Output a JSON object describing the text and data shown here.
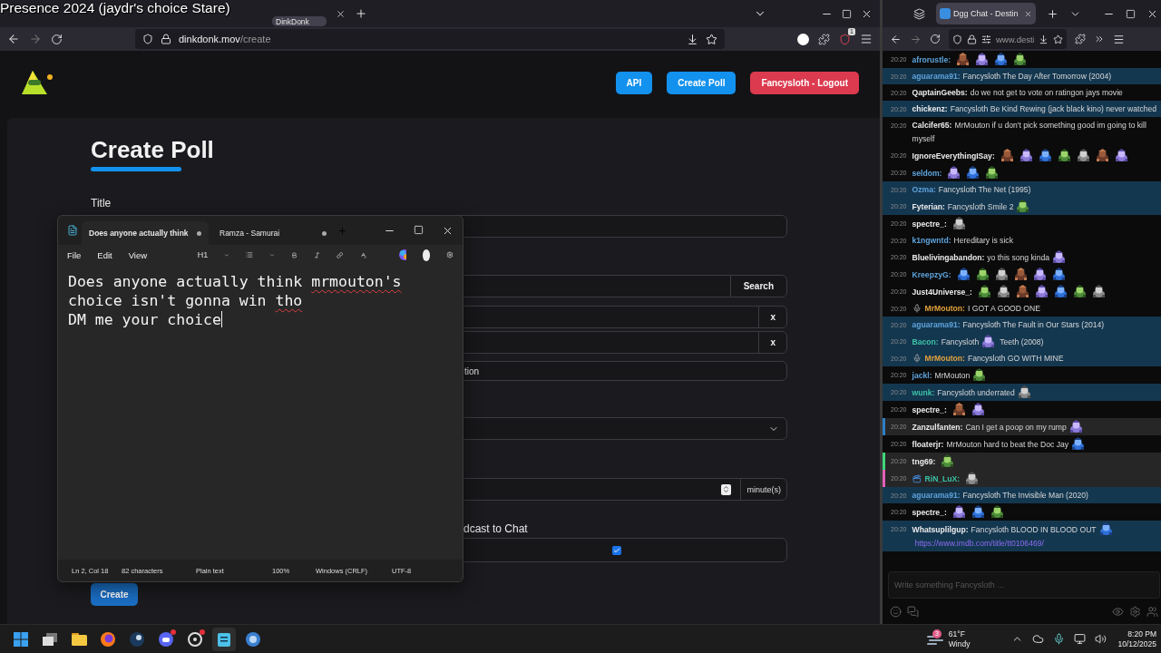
{
  "overlay_title": "Presence 2024 (jaydr's choice Stare)",
  "left_browser": {
    "tab": {
      "title": "DinkDonk",
      "selected": true
    },
    "address": {
      "host": "dinkdonk.mov",
      "path": "/create"
    },
    "extension_badge": "1",
    "header_buttons": [
      {
        "label": "API",
        "kind": "primary"
      },
      {
        "label": "Create Poll",
        "kind": "primary"
      },
      {
        "label": "Fancysloth - Logout",
        "kind": "danger"
      }
    ],
    "form": {
      "heading": "Create Poll",
      "title_label": "Title",
      "search_button": "Search",
      "options": [
        {
          "remove": "x"
        },
        {
          "remove": "x"
        }
      ],
      "partial_field_text": "tion",
      "duration_unit": "minute(s)",
      "broadcast_label": "dcast to Chat",
      "broadcast": {
        "checked": true
      },
      "create_button": "Create"
    }
  },
  "notepad": {
    "tabs": [
      {
        "title": "Does anyone actually think",
        "selected": true,
        "unsaved": true
      },
      {
        "title": "Ramza - Samurai",
        "selected": false,
        "unsaved": true
      }
    ],
    "menu": [
      "File",
      "Edit",
      "View"
    ],
    "heading_menu": "H1",
    "lines": [
      {
        "segments": [
          {
            "text": "Does anyone actually think ",
            "misspelled": false
          },
          {
            "text": "mrmouton's",
            "misspelled": true
          }
        ],
        "caret": false
      },
      {
        "segments": [
          {
            "text": "choice isn't gonna win ",
            "misspelled": false
          },
          {
            "text": "tho",
            "misspelled": true
          }
        ],
        "caret": false
      },
      {
        "segments": [
          {
            "text": "DM me your choice",
            "misspelled": false
          }
        ],
        "caret": true
      }
    ],
    "status": [
      "Ln 2, Col 18",
      "82 characters",
      "Plain text",
      "100%",
      "Windows (CRLF)",
      "UTF-8"
    ]
  },
  "right_browser": {
    "tab": {
      "title": "Dgg Chat - Destin",
      "selected": true
    },
    "address": "www.desti",
    "messages": [
      {
        "time": "20:20",
        "user": "afrorustle:",
        "color": "#5ea3dc",
        "highlighted": false
      },
      {
        "time": "20:20",
        "user": "aguarama91:",
        "color": "#5ea3dc",
        "highlighted": true,
        "text": "Fancysloth The Day After Tomorrow (2004)"
      },
      {
        "time": "20:20",
        "user": "QaptainGeebs:",
        "color": "#ececec",
        "highlighted": false,
        "text": "do we not get to vote on ratingon jays movie"
      },
      {
        "time": "20:20",
        "user": "chickenz:",
        "color": "#ececec",
        "highlighted": true,
        "text": "Fancysloth Be Kind Rewing (jack black kino) never watched"
      },
      {
        "time": "20:20",
        "user": "Calcifer65:",
        "color": "#ececec",
        "highlighted": false,
        "text": "MrMouton if u don't pick something good im going to kill myself"
      },
      {
        "time": "20:20",
        "user": "IgnoreEverythingISay:",
        "color": "#ececec",
        "highlighted": false
      },
      {
        "time": "20:20",
        "user": "seldom:",
        "color": "#5ea3dc",
        "highlighted": false
      },
      {
        "time": "20:20",
        "user": "Ozma:",
        "color": "#5ea3dc",
        "highlighted": true,
        "text": "Fancysloth The Net (1995)"
      },
      {
        "time": "20:20",
        "user": "Fyterian:",
        "color": "#ececec",
        "highlighted": true,
        "text": "Fancysloth Smile 2"
      },
      {
        "time": "20:20",
        "user": "spectre_:",
        "color": "#ececec",
        "highlighted": false
      },
      {
        "time": "20:20",
        "user": "k1ngwntd:",
        "color": "#5ea3dc",
        "highlighted": false,
        "text": "Hereditary is sick"
      },
      {
        "time": "20:20",
        "user": "Bluelivingabandon:",
        "color": "#ececec",
        "highlighted": false,
        "text": "yo this song kinda"
      },
      {
        "time": "20:20",
        "user": "KreepzyG:",
        "color": "#5ea3dc",
        "highlighted": false
      },
      {
        "time": "20:20",
        "user": "Just4Universe_:",
        "color": "#ececec",
        "highlighted": false
      },
      {
        "time": "20:20",
        "badge": {
          "kind": "mic"
        },
        "user": "MrMouton:",
        "color": "#e3a23c",
        "highlighted": false,
        "text": "I GOT A GOOD ONE"
      },
      {
        "time": "20:20",
        "user": "aguarama91:",
        "color": "#5ea3dc",
        "highlighted": true,
        "text": "Fancysloth The Fault in Our Stars (2014)"
      },
      {
        "time": "20:20",
        "user": "Bacon:",
        "color": "#3cc2a6",
        "highlighted": true,
        "text": "Fancysloth",
        "text_after": "Teeth (2008)"
      },
      {
        "time": "20:20",
        "badge": {
          "kind": "mic"
        },
        "user": "MrMouton:",
        "color": "#e3a23c",
        "highlighted": true,
        "text": "Fancysloth GO WITH MINE"
      },
      {
        "time": "20:20",
        "user": "jackl:",
        "color": "#5ea3dc",
        "highlighted": false,
        "text": "MrMouton"
      },
      {
        "time": "20:20",
        "user": "wunk:",
        "color": "#3cc2a6",
        "highlighted": true,
        "text": "Fancysloth underrated"
      },
      {
        "time": "20:20",
        "user": "spectre_:",
        "color": "#ececec",
        "highlighted": false
      },
      {
        "time": "20:20",
        "user": "Zanzulfanten:",
        "color": "#ececec",
        "highlighted": false,
        "stripe": {
          "color": "#2f7fc4"
        },
        "text": "Can I get a poop on my rump"
      },
      {
        "time": "20:20",
        "user": "floaterjr:",
        "color": "#ececec",
        "highlighted": false,
        "text": "MrMouton hard to beat the Doc Jay"
      },
      {
        "time": "20:20",
        "user": "tng69:",
        "color": "#ececec",
        "highlighted": false,
        "stripe": {
          "color": "#3fd67a"
        }
      },
      {
        "time": "20:20",
        "badge": {
          "kind": "clapper"
        },
        "user": "RiN_LuX:",
        "color": "#3cc2a6",
        "highlighted": false,
        "stripe": {
          "color": "#e060b8"
        }
      },
      {
        "time": "20:20",
        "user": "aguarama91:",
        "color": "#5ea3dc",
        "highlighted": true,
        "text": "Fancysloth The Invisible Man (2020)"
      },
      {
        "time": "20:20",
        "user": "spectre_:",
        "color": "#ececec",
        "highlighted": false
      },
      {
        "time": "20:20",
        "user": "Whatsuplilgup:",
        "color": "#ececec",
        "highlighted": true,
        "text": "Fancysloth BLOOD IN BLOOD OUT",
        "link": "https://www.imdb.com/title/tt0106469/"
      }
    ],
    "input_placeholder": "Write something Fancysloth ..."
  },
  "taskbar": {
    "apps": [
      {
        "kind": "start",
        "active": false,
        "notification": false
      },
      {
        "kind": "taskview",
        "active": false,
        "notification": false
      },
      {
        "kind": "folder",
        "active": false,
        "notification": false
      },
      {
        "kind": "fox",
        "active": false,
        "notification": false
      },
      {
        "kind": "steam",
        "active": false,
        "notification": false
      },
      {
        "kind": "chat",
        "active": false,
        "notification": true
      },
      {
        "kind": "dial",
        "active": false,
        "notification": true
      },
      {
        "kind": "notepad",
        "active": true,
        "notification": false
      },
      {
        "kind": "torrent",
        "active": false,
        "notification": false
      }
    ],
    "weather": {
      "badge": "3",
      "temperature": "61°F",
      "condition": "Windy"
    },
    "time": "8:20 PM",
    "date": "10/12/2025"
  }
}
